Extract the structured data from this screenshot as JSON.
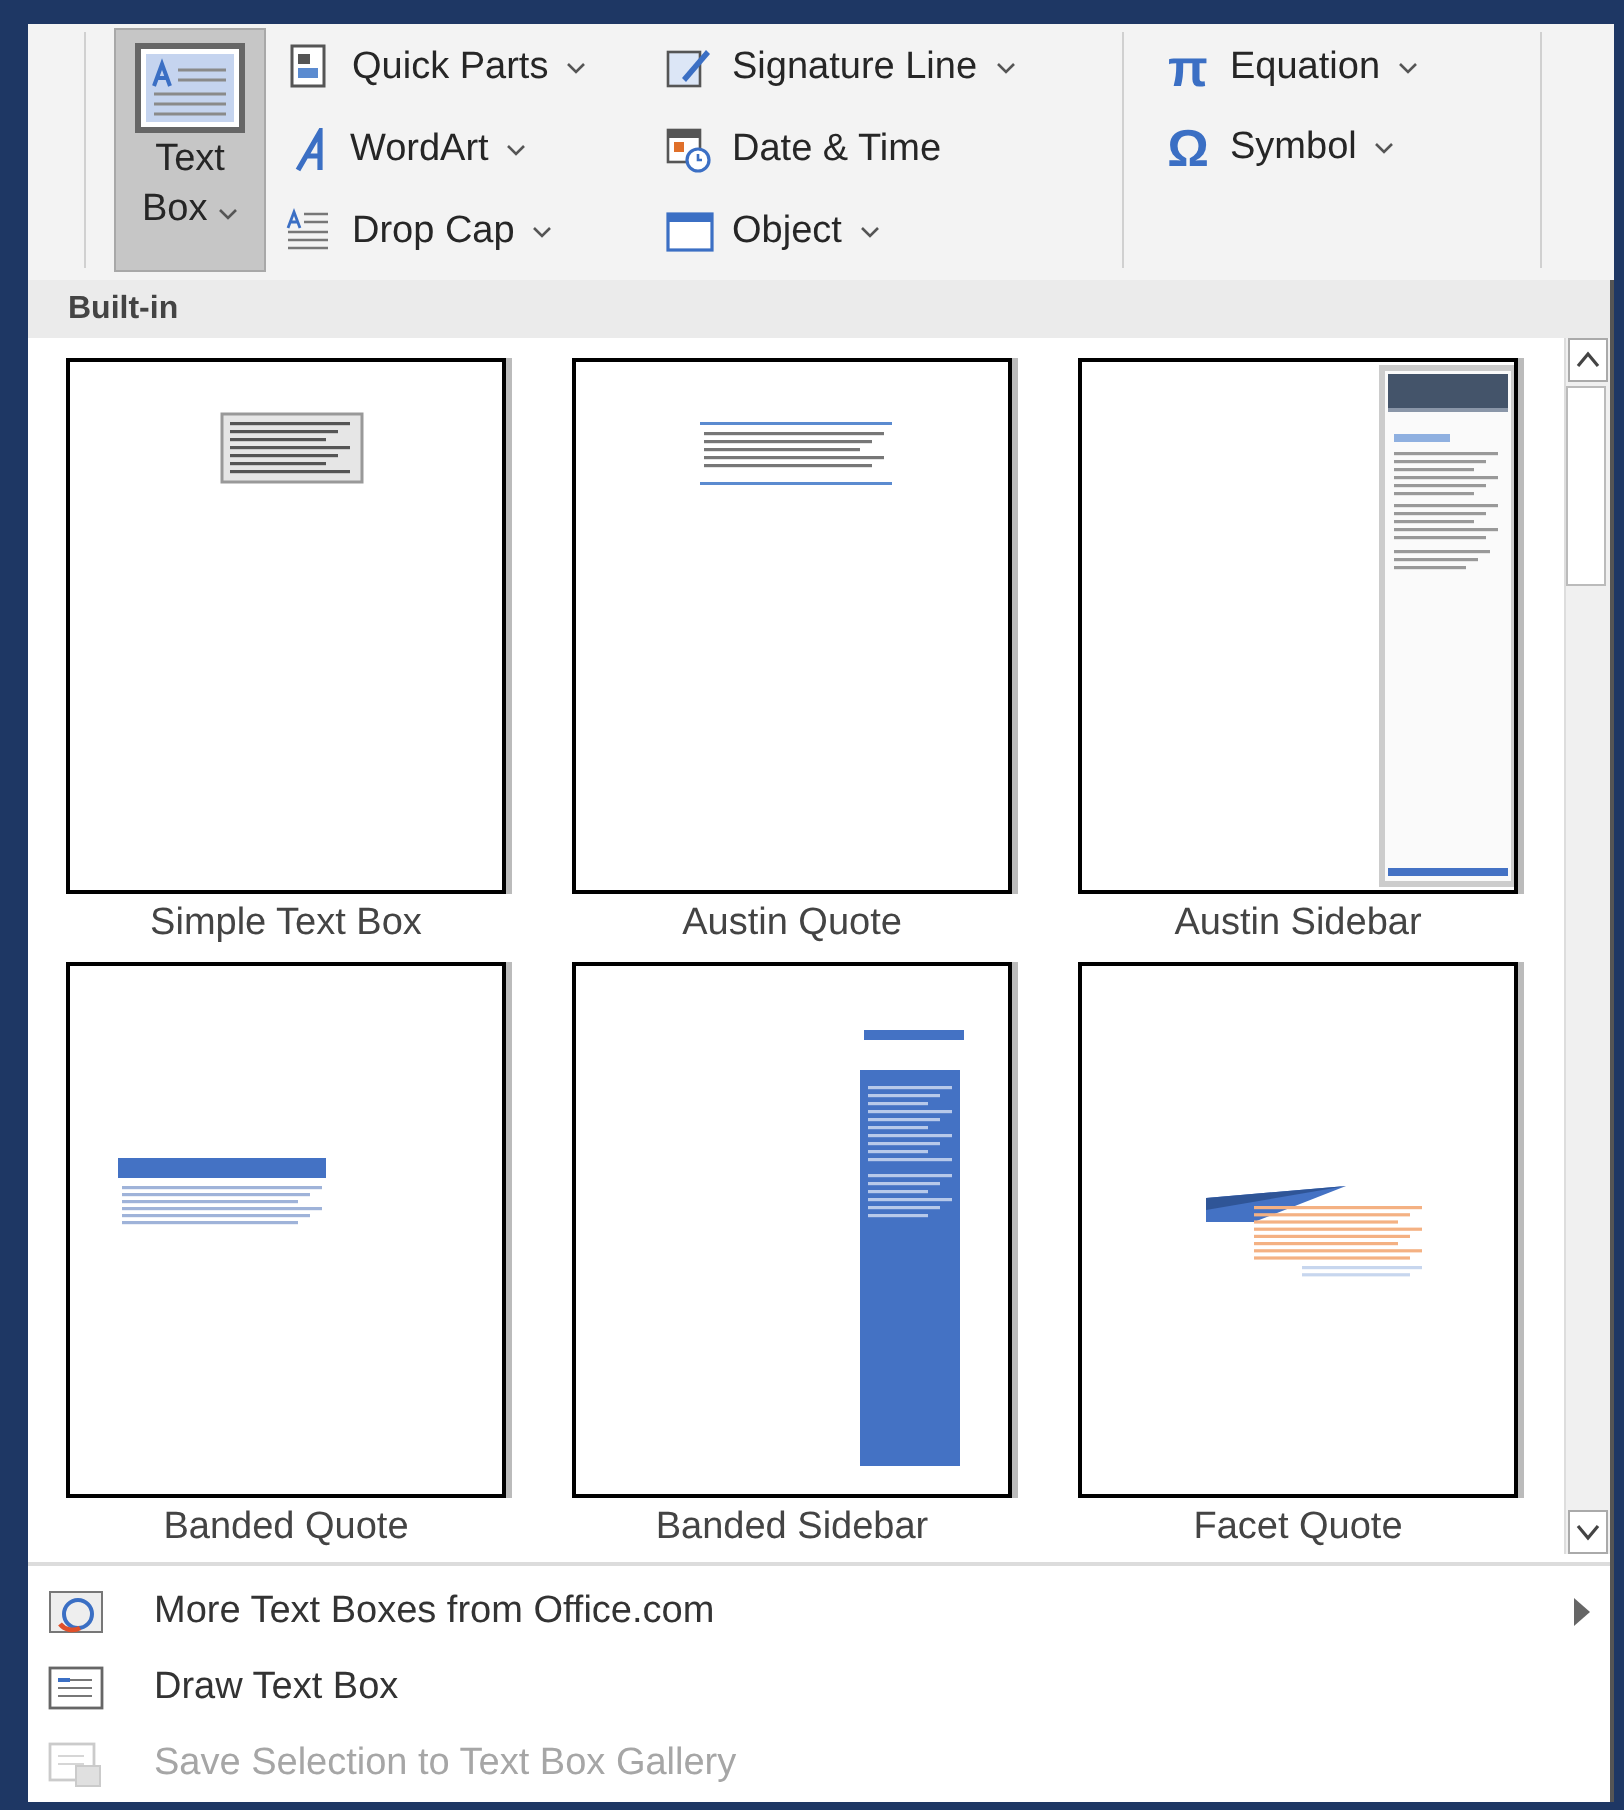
{
  "ribbon": {
    "large_button": {
      "label": "Text Box",
      "selected": true,
      "has_menu": true
    },
    "groups": [
      {
        "tools": [
          {
            "kind": "quick-parts",
            "label": "Quick Parts",
            "has_menu": true
          },
          {
            "kind": "wordart",
            "label": "WordArt",
            "has_menu": true
          },
          {
            "kind": "drop-cap",
            "label": "Drop Cap",
            "has_menu": true
          }
        ]
      },
      {
        "tools": [
          {
            "kind": "signature-line",
            "label": "Signature Line",
            "has_menu": true
          },
          {
            "kind": "date-time",
            "label": "Date & Time",
            "has_menu": false
          },
          {
            "kind": "object",
            "label": "Object",
            "has_menu": true
          }
        ]
      },
      {
        "tools": [
          {
            "kind": "glyph",
            "glyph": "π",
            "label": "Equation",
            "has_menu": true
          },
          {
            "kind": "glyph",
            "glyph": "Ω",
            "label": "Symbol",
            "has_menu": true
          }
        ]
      }
    ]
  },
  "gallery": {
    "header": "Built-in",
    "items": [
      {
        "label": "Simple Text Box",
        "kind": "simple"
      },
      {
        "label": "Austin Quote",
        "kind": "austin-quote"
      },
      {
        "label": "Austin Sidebar",
        "kind": "austin-sidebar"
      },
      {
        "label": "Banded Quote",
        "kind": "banded-quote"
      },
      {
        "label": "Banded Sidebar",
        "kind": "banded-sidebar"
      },
      {
        "label": "Facet Quote",
        "kind": "facet-quote"
      }
    ]
  },
  "menu": [
    {
      "kind": "online",
      "label": "More Text Boxes from Office.com",
      "submenu": true,
      "disabled": false
    },
    {
      "kind": "draw",
      "label": "Draw Text Box",
      "submenu": false,
      "disabled": false
    },
    {
      "kind": "save",
      "label": "Save Selection to Text Box Gallery",
      "submenu": false,
      "disabled": true
    }
  ]
}
